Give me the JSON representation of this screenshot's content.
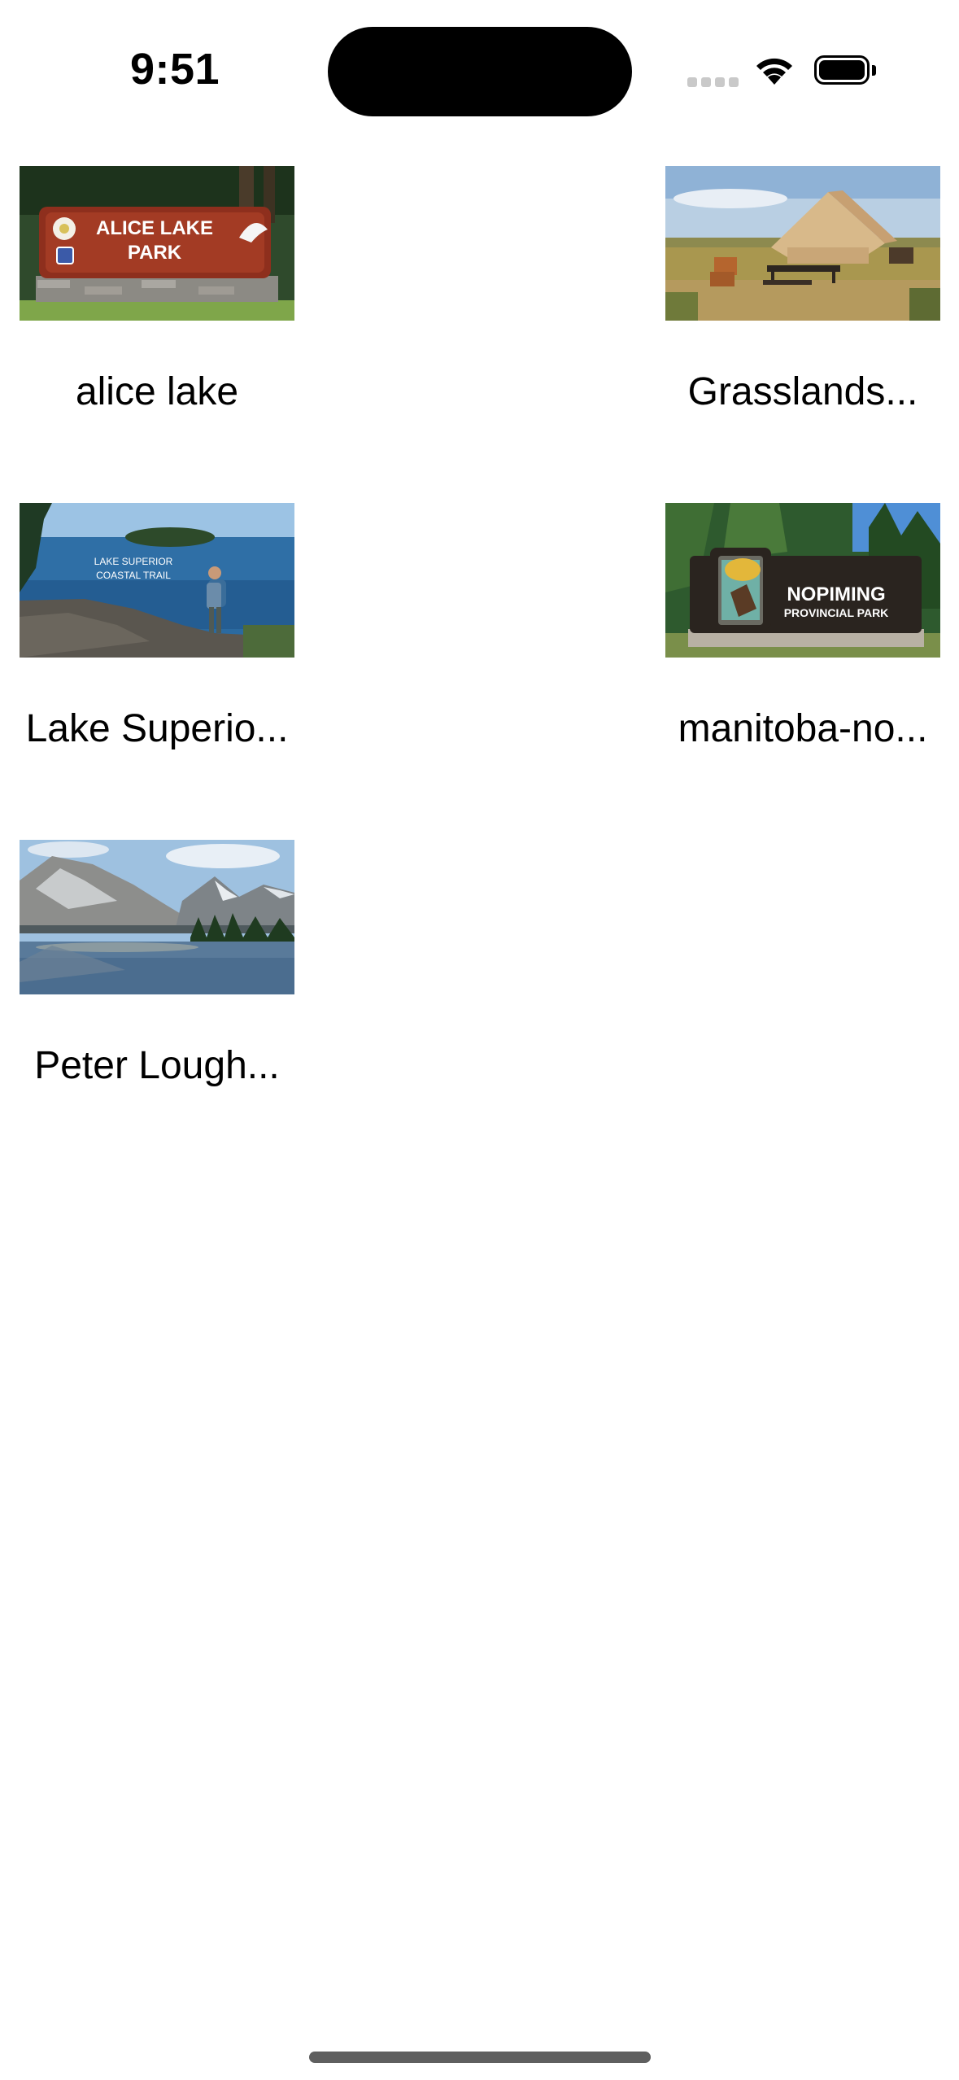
{
  "status_bar": {
    "time": "9:51",
    "icons": [
      "cellular-signal-icon",
      "wifi-icon",
      "battery-icon"
    ]
  },
  "parks": [
    {
      "name": "alice lake",
      "sign_lines": [
        "ALICE LAKE",
        "PARK"
      ]
    },
    {
      "name": "Grasslands..."
    },
    {
      "name": "Lake Superio...",
      "sign_lines": [
        "LAKE SUPERIOR",
        "COASTAL TRAIL"
      ]
    },
    {
      "name": "manitoba-no...",
      "sign_lines": [
        "NOPIMING",
        "PROVINCIAL PARK"
      ]
    },
    {
      "name": "Peter Lough..."
    }
  ]
}
